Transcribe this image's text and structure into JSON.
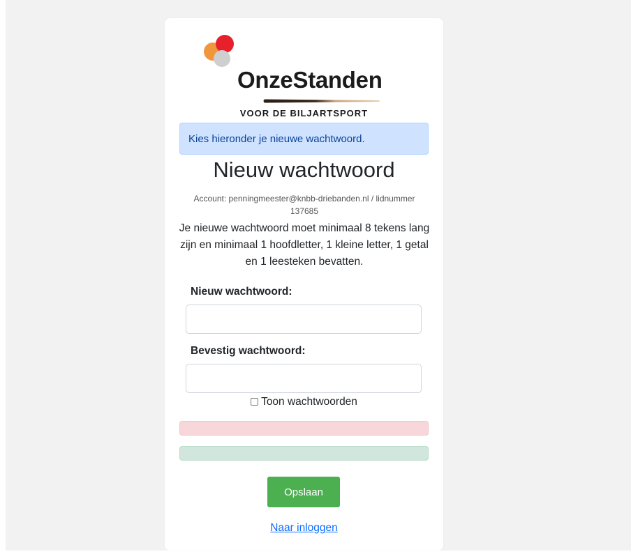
{
  "brand": {
    "name": "OnzeStanden",
    "tagline": "VOOR DE BILJARTSPORT",
    "colors": {
      "red": "#e8202b",
      "orange": "#f0963c",
      "gray": "#cfcfcf"
    }
  },
  "info_alert": {
    "text": "Kies hieronder je nieuwe wachtwoord."
  },
  "page_title": "Nieuw wachtwoord",
  "account_text": "Account: penningmeester@knbb-driebanden.nl / lidnummer 137685",
  "password_rules": "Je nieuwe wachtwoord moet minimaal 8 tekens lang zijn en minimaal 1 hoofdletter, 1 kleine letter, 1 getal en 1 leesteken bevatten.",
  "form": {
    "new_password_label": "Nieuw wachtwoord:",
    "new_password_value": "",
    "confirm_password_label": "Bevestig wachtwoord:",
    "confirm_password_value": "",
    "show_passwords_label": "Toon wachtwoorden",
    "show_passwords_checked": false,
    "save_label": "Opslaan"
  },
  "error_alert": {
    "text": ""
  },
  "success_alert": {
    "text": ""
  },
  "login_link_label": "Naar inloggen",
  "colors": {
    "info_bg": "#cfe2ff",
    "info_text": "#084298",
    "danger_bg": "#f8d7da",
    "success_bg": "#d1e7dd",
    "save_button": "#4caf50",
    "link": "#0d6efd"
  }
}
